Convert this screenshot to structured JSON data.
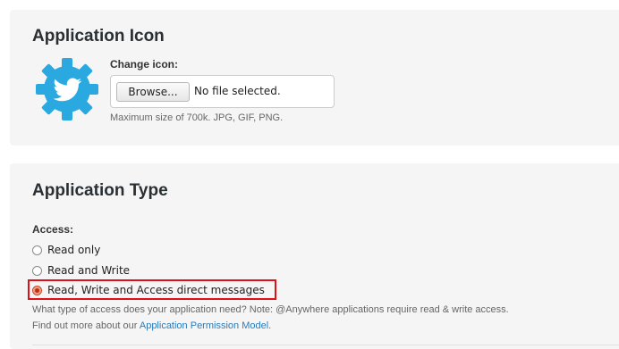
{
  "icon_section": {
    "title": "Application Icon",
    "icon": "twitter-bird-gear-icon",
    "change_label": "Change icon:",
    "browse_label": "Browse...",
    "file_status": "No file selected.",
    "size_hint": "Maximum size of 700k. JPG, GIF, PNG."
  },
  "type_section": {
    "title": "Application Type",
    "access_label": "Access:",
    "options": [
      {
        "label": "Read only",
        "selected": false
      },
      {
        "label": "Read and Write",
        "selected": false
      },
      {
        "label": "Read, Write and Access direct messages",
        "selected": true
      }
    ],
    "help_text": "What type of access does your application need? Note: @Anywhere applications require read & write access.",
    "more_prefix": "Find out more about our ",
    "more_link": "Application Permission Model",
    "more_suffix": "."
  },
  "colors": {
    "panel_bg": "#f5f5f5",
    "icon_blue": "#2aa9e0",
    "highlight_red": "#e0101a",
    "link": "#2b7bb9"
  }
}
